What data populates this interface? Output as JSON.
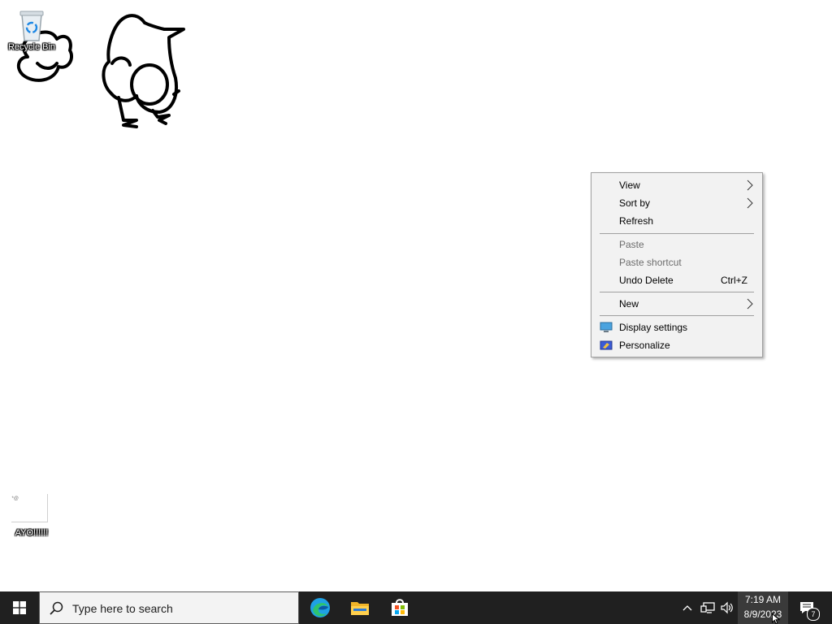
{
  "desktop": {
    "icons": [
      {
        "label": "Recycle Bin"
      },
      {
        "label": "AYO!!!!!!",
        "thumb_mark": "*@"
      }
    ]
  },
  "context_menu": {
    "items": [
      {
        "label": "View",
        "submenu": true
      },
      {
        "label": "Sort by",
        "submenu": true
      },
      {
        "label": "Refresh"
      },
      {
        "label": "Paste",
        "disabled": true
      },
      {
        "label": "Paste shortcut",
        "disabled": true
      },
      {
        "label": "Undo Delete",
        "shortcut": "Ctrl+Z"
      },
      {
        "label": "New",
        "submenu": true
      },
      {
        "label": "Display settings",
        "icon": "display-icon"
      },
      {
        "label": "Personalize",
        "icon": "personalize-icon"
      }
    ]
  },
  "taskbar": {
    "search_placeholder": "Type here to search",
    "pinned_apps": [
      "edge-icon",
      "file-explorer-icon",
      "store-icon"
    ],
    "clock": {
      "time": "7:19 AM",
      "date": "8/9/2023"
    },
    "notifications_count": "7"
  },
  "colors": {
    "taskbar": "#202020",
    "menu_bg": "#f2f2f2",
    "desktop": "#ffffff",
    "accent": "#0078d7"
  }
}
